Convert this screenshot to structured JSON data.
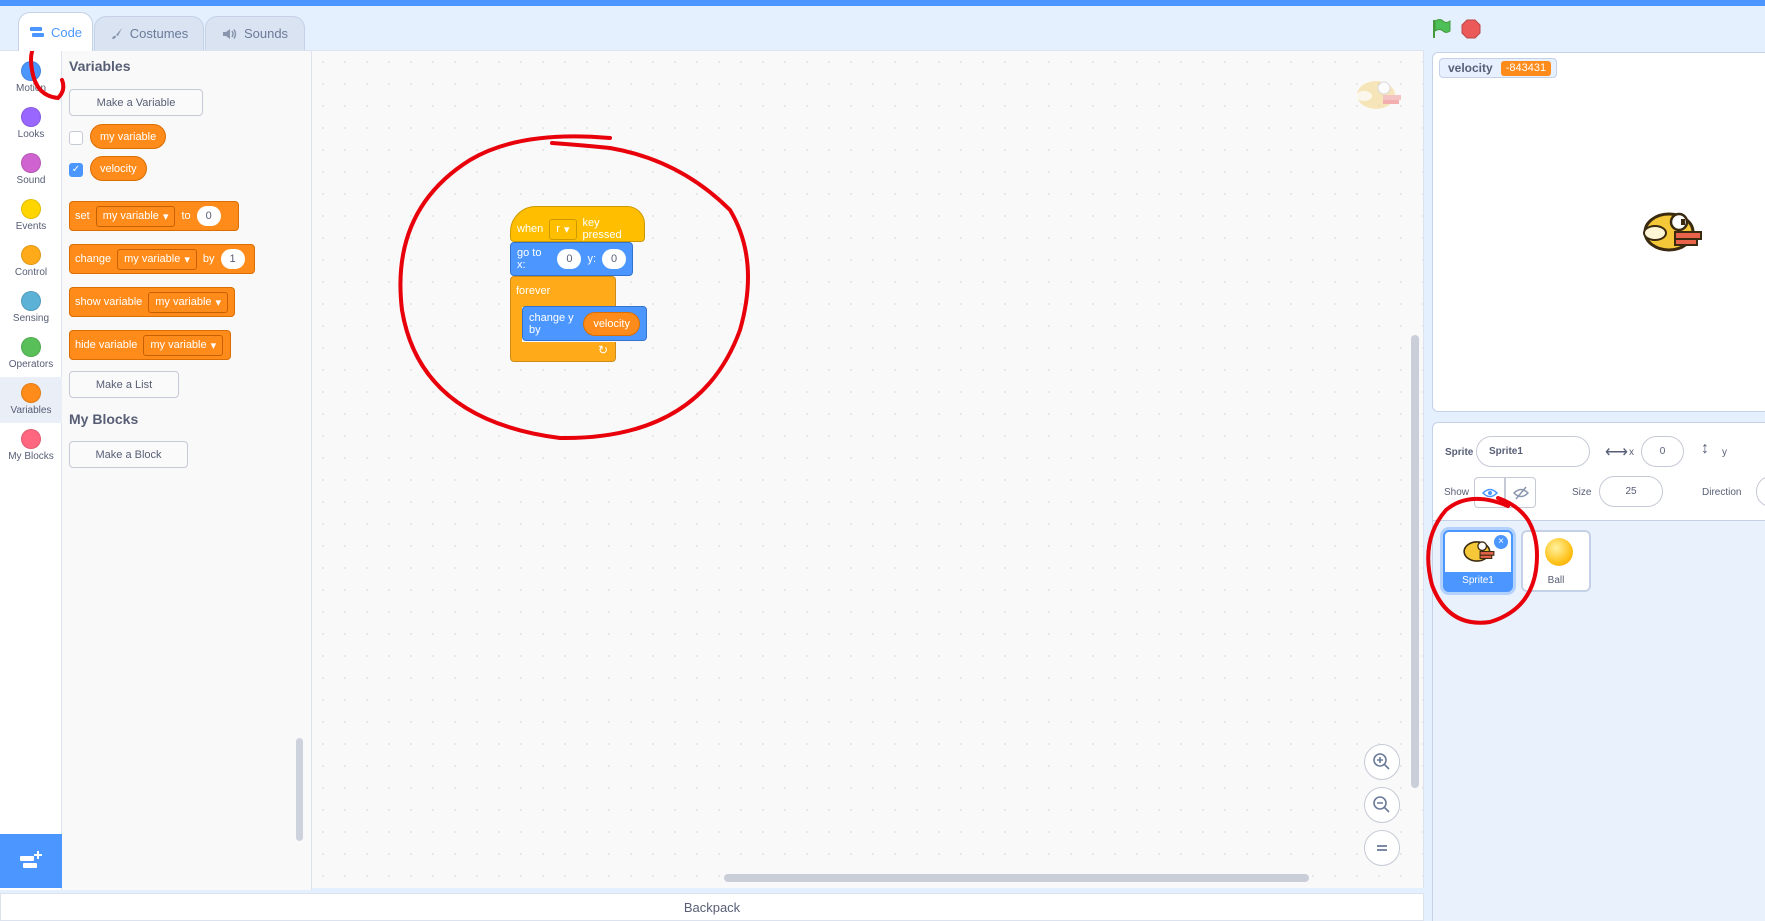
{
  "tabs": [
    {
      "label": "Code",
      "icon": "code-icon"
    },
    {
      "label": "Costumes",
      "icon": "brush-icon"
    },
    {
      "label": "Sounds",
      "icon": "speaker-icon"
    }
  ],
  "categories": [
    {
      "label": "Motion",
      "color": "#4c97ff"
    },
    {
      "label": "Looks",
      "color": "#9966ff"
    },
    {
      "label": "Sound",
      "color": "#cf63cf"
    },
    {
      "label": "Events",
      "color": "#ffd500"
    },
    {
      "label": "Control",
      "color": "#ffab19"
    },
    {
      "label": "Sensing",
      "color": "#5cb1d6"
    },
    {
      "label": "Operators",
      "color": "#59c059"
    },
    {
      "label": "Variables",
      "color": "#ff8c1a"
    },
    {
      "label": "My Blocks",
      "color": "#ff6680"
    }
  ],
  "palette": {
    "variables_heading": "Variables",
    "make_variable": "Make a Variable",
    "variables": [
      {
        "name": "my variable",
        "checked": false
      },
      {
        "name": "velocity",
        "checked": true
      }
    ],
    "blocks": {
      "set": {
        "label": "set",
        "var": "my variable",
        "to": "to",
        "value": "0"
      },
      "change": {
        "label": "change",
        "var": "my variable",
        "by": "by",
        "value": "1"
      },
      "show": {
        "label": "show variable",
        "var": "my variable"
      },
      "hide": {
        "label": "hide variable",
        "var": "my variable"
      }
    },
    "make_list": "Make a List",
    "myblocks_heading": "My Blocks",
    "make_block": "Make a Block"
  },
  "script": {
    "hat": {
      "when": "when",
      "key": "r",
      "suffix": "key pressed"
    },
    "goto": {
      "label": "go to x:",
      "x": "0",
      "ylabel": "y:",
      "y": "0"
    },
    "forever": "forever",
    "change_y": {
      "label": "change y by",
      "reporter": "velocity"
    }
  },
  "backpack": "Backpack",
  "stage": {
    "monitor_label": "velocity",
    "monitor_value": "-843431"
  },
  "sprite_info": {
    "sprite_label": "Sprite",
    "sprite_name": "Sprite1",
    "x_label": "x",
    "x_value": "0",
    "y_label": "y",
    "show_label": "Show",
    "size_label": "Size",
    "size_value": "25",
    "direction_label": "Direction"
  },
  "sprites": [
    {
      "name": "Sprite1",
      "selected": true
    },
    {
      "name": "Ball",
      "selected": false
    }
  ],
  "colors": {
    "accent": "#4c97ff",
    "variables": "#ff8c1a",
    "events": "#ffbf00",
    "motion": "#4c97ff",
    "control": "#ffab19",
    "annotation": "#e8000b"
  }
}
